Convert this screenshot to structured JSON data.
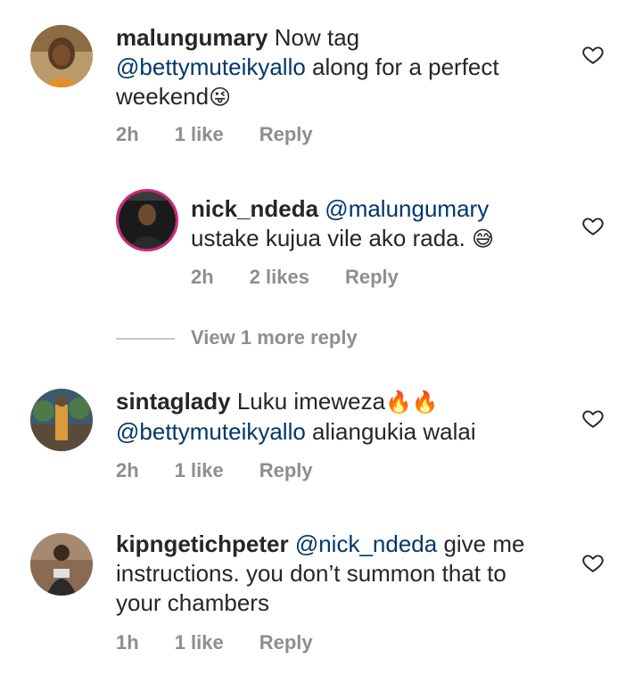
{
  "comments": [
    {
      "username": "malungumary",
      "text_before": "Now tag",
      "mention": "@bettymuteikyallo",
      "text_after": " along for a perfect",
      "line3": "weekend",
      "emoji": "😜",
      "time": "2h",
      "likes": "1 like",
      "reply": "Reply"
    },
    {
      "username": "nick_ndeda",
      "mention": "@malungumary",
      "text": "ustake kujua vile ako rada.",
      "emoji": "😅",
      "time": "2h",
      "likes": "2 likes",
      "reply": "Reply"
    },
    {
      "username": "sintaglady",
      "text": "Luku imeweza",
      "emoji": "🔥🔥",
      "mention": "@bettymuteikyallo",
      "text_after": " aliangukia walai",
      "time": "2h",
      "likes": "1 like",
      "reply": "Reply"
    },
    {
      "username": "kipngetichpeter",
      "mention": "@nick_ndeda",
      "text": " give me",
      "line2": "instructions. you don’t summon that to",
      "line3": "your chambers",
      "time": "1h",
      "likes": "1 like",
      "reply": "Reply"
    }
  ],
  "view_more": "View 1 more reply",
  "icons": {
    "heart": "heart-outline-icon"
  },
  "colors": {
    "text": "#262626",
    "meta": "#8e8e8e",
    "mention": "#00376b",
    "story_ring": "#d0267a"
  }
}
